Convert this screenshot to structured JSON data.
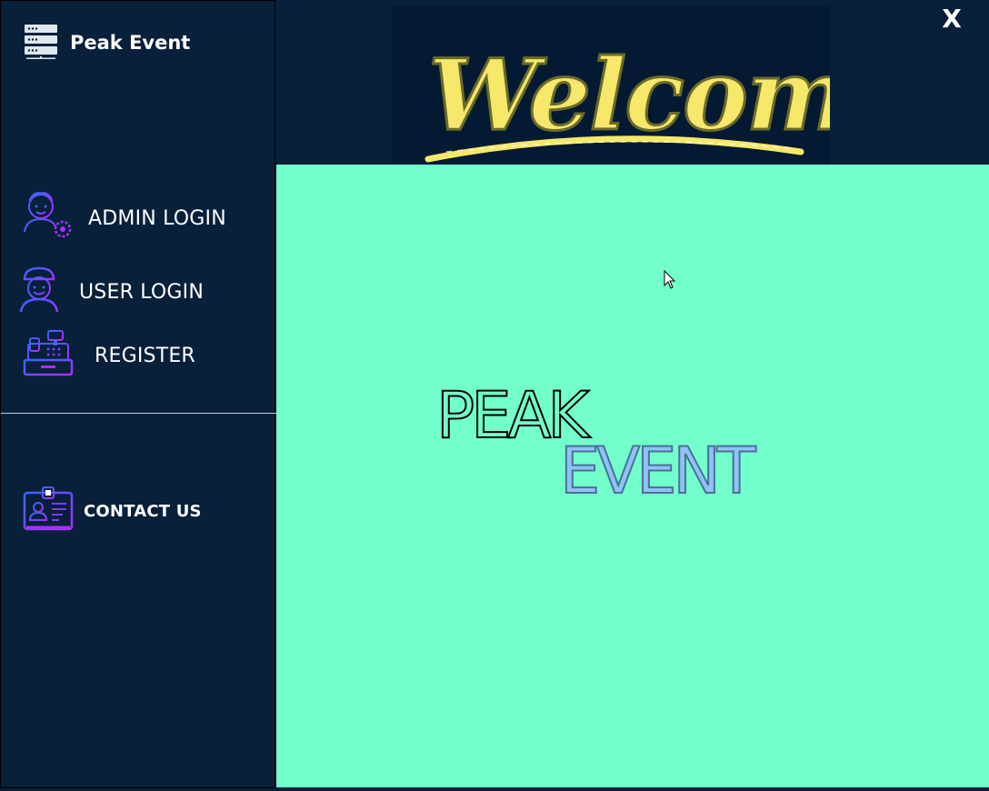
{
  "app": {
    "title": "Peak Event"
  },
  "sidebar": {
    "items": [
      {
        "label": "ADMIN LOGIN",
        "icon": "admin-gear-icon"
      },
      {
        "label": "USER LOGIN",
        "icon": "user-icon"
      },
      {
        "label": "REGISTER",
        "icon": "cash-register-icon"
      },
      {
        "label": "CONTACT US",
        "icon": "id-card-icon"
      }
    ]
  },
  "banner": {
    "text": "Welcome"
  },
  "window": {
    "close_label": "X"
  },
  "logo": {
    "line1": "PEAK",
    "line2": "EVENT"
  },
  "colors": {
    "sidebar_bg": "#08203a",
    "main_bg": "#73ffcb",
    "banner_yellow": "#f5e86a",
    "icon_purple": "#7a3cff",
    "logo_blue": "#8fc3f5"
  }
}
